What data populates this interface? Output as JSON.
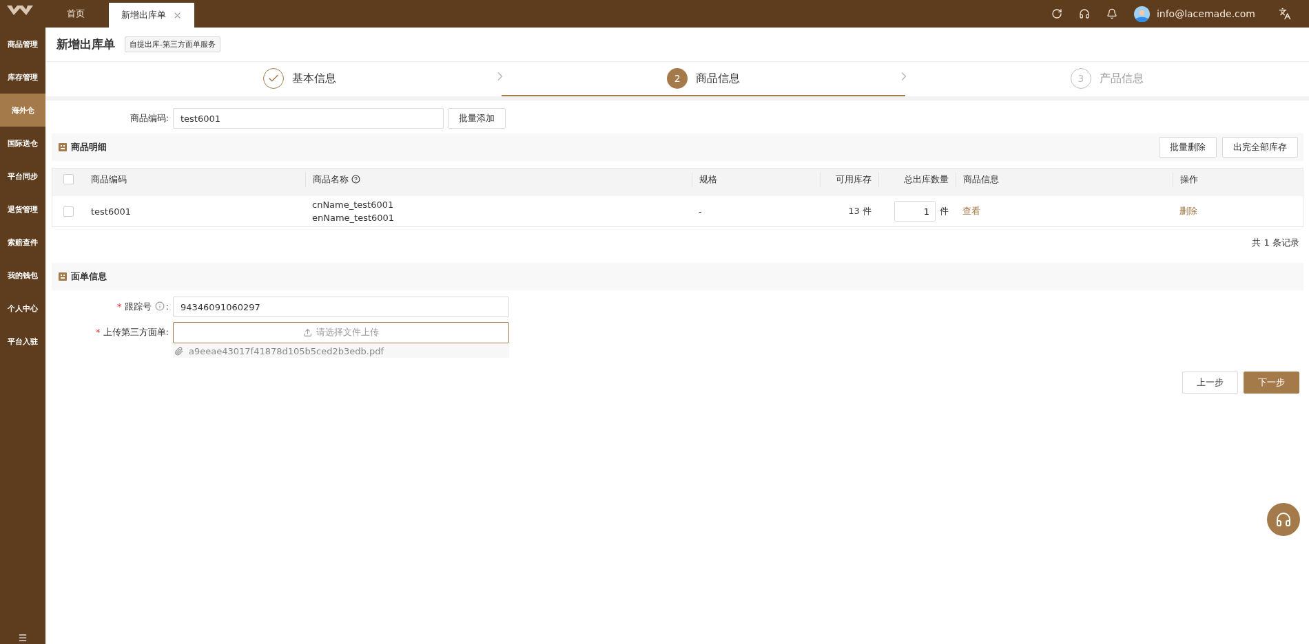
{
  "top_bar": {
    "tabs": [
      {
        "label": "首页",
        "selected": false,
        "closable": false
      },
      {
        "label": "新增出库单",
        "selected": true,
        "closable": true
      }
    ],
    "user_email": "info@lacemade.com"
  },
  "sidebar": {
    "items": [
      {
        "label": "商品管理",
        "selected": false
      },
      {
        "label": "库存管理",
        "selected": false
      },
      {
        "label": "海外仓",
        "selected": true
      },
      {
        "label": "国际送仓",
        "selected": false
      },
      {
        "label": "平台同步",
        "selected": false
      },
      {
        "label": "退货管理",
        "selected": false
      },
      {
        "label": "索赔查件",
        "selected": false
      },
      {
        "label": "我的钱包",
        "selected": false
      },
      {
        "label": "个人中心",
        "selected": false
      },
      {
        "label": "平台入驻",
        "selected": false
      }
    ]
  },
  "page": {
    "title": "新增出库单",
    "tag": "自提出库-第三方面单服务"
  },
  "steps": [
    {
      "label": "基本信息",
      "kind": "done"
    },
    {
      "number": "2",
      "label": "商品信息",
      "kind": "active"
    },
    {
      "number": "3",
      "label": "产品信息",
      "kind": "pending"
    }
  ],
  "product_code": {
    "label": "商品编码:",
    "value": "test6001",
    "button": "批量添加"
  },
  "details": {
    "title": "商品明细",
    "actions": [
      "批量删除",
      "出完全部库存"
    ],
    "header_checked": false,
    "columns": [
      {
        "label": "商品编码",
        "help": false
      },
      {
        "label": "商品名称",
        "help": true
      },
      {
        "label": "规格",
        "help": false
      },
      {
        "label": "可用库存",
        "help": false
      },
      {
        "label": "总出库数量",
        "help": false
      },
      {
        "label": "商品信息",
        "help": false
      },
      {
        "label": "操作",
        "help": false
      }
    ],
    "rows": [
      {
        "checked": false,
        "code": "test6001",
        "names": [
          "cnName_test6001",
          "enName_test6001"
        ],
        "spec": "-",
        "stock": "13 件",
        "quantity": "1",
        "unit": "件",
        "info_link": "查看",
        "action": "删除"
      }
    ],
    "total": "共 1 条记录"
  },
  "waybill": {
    "title": "面单信息",
    "tracking": {
      "required_mark": "*",
      "label": "跟踪号",
      "colon": ":",
      "value": "94346091060297"
    },
    "upload": {
      "required_mark": "*",
      "label": "上传第三方面单:",
      "placeholder": "请选择文件上传",
      "file": "a9eeae43017f41878d105b5ced2b3edb.pdf"
    }
  },
  "footer_buttons": [
    {
      "label": "上一步",
      "kind": "secondary"
    },
    {
      "label": "下一步",
      "kind": "primary"
    }
  ]
}
